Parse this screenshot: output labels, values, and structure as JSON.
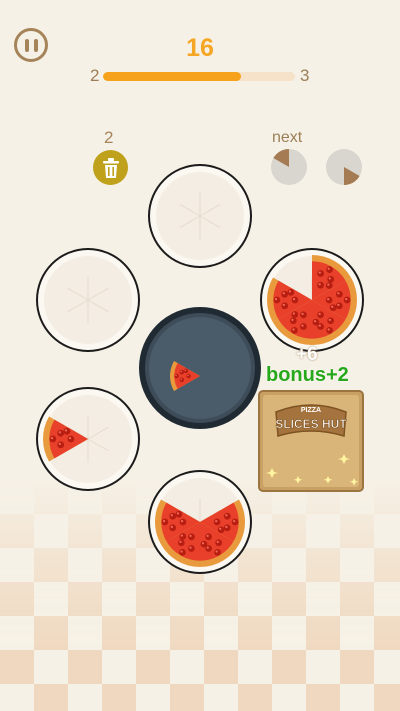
{
  "hud": {
    "score": "16",
    "level_from": "2",
    "level_to": "3",
    "progress": 0.72
  },
  "trash": {
    "count": "2"
  },
  "next": {
    "label": "next",
    "queue": [
      {
        "slices": 1
      },
      {
        "slices": 1
      }
    ]
  },
  "plates": [
    {
      "name": "plate-top",
      "slices": []
    },
    {
      "name": "plate-upper-left",
      "slices": []
    },
    {
      "name": "plate-upper-right",
      "slices": [
        0,
        1,
        2,
        3,
        4
      ]
    },
    {
      "name": "plate-center-pan",
      "slices": [
        4
      ],
      "pan": true
    },
    {
      "name": "plate-lower-left",
      "slices": [
        4
      ]
    },
    {
      "name": "plate-bottom",
      "slices": [
        1,
        2,
        3,
        4
      ]
    }
  ],
  "bonus": {
    "plus_text": "+6",
    "bonus_text": "bonus+2"
  },
  "box": {
    "line1": "PIZZA",
    "line2": "SLICES HUT"
  },
  "colors": {
    "accent": "#f5a623",
    "bonus": "#27a81b",
    "trash": "#bfa11b"
  }
}
